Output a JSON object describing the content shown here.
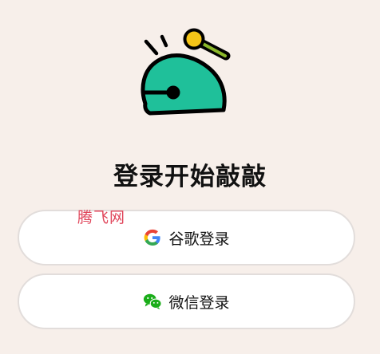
{
  "page": {
    "title": "登录开始敲敲",
    "watermark": "腾飞网"
  },
  "buttons": {
    "google": {
      "label": "谷歌登录",
      "icon": "google-icon"
    },
    "wechat": {
      "label": "微信登录",
      "icon": "wechat-icon"
    }
  },
  "colors": {
    "background": "#f7efea",
    "logo_green": "#1fc09a",
    "logo_yellow": "#f5c518",
    "wechat_green": "#1aad19",
    "watermark": "#e0455a"
  }
}
